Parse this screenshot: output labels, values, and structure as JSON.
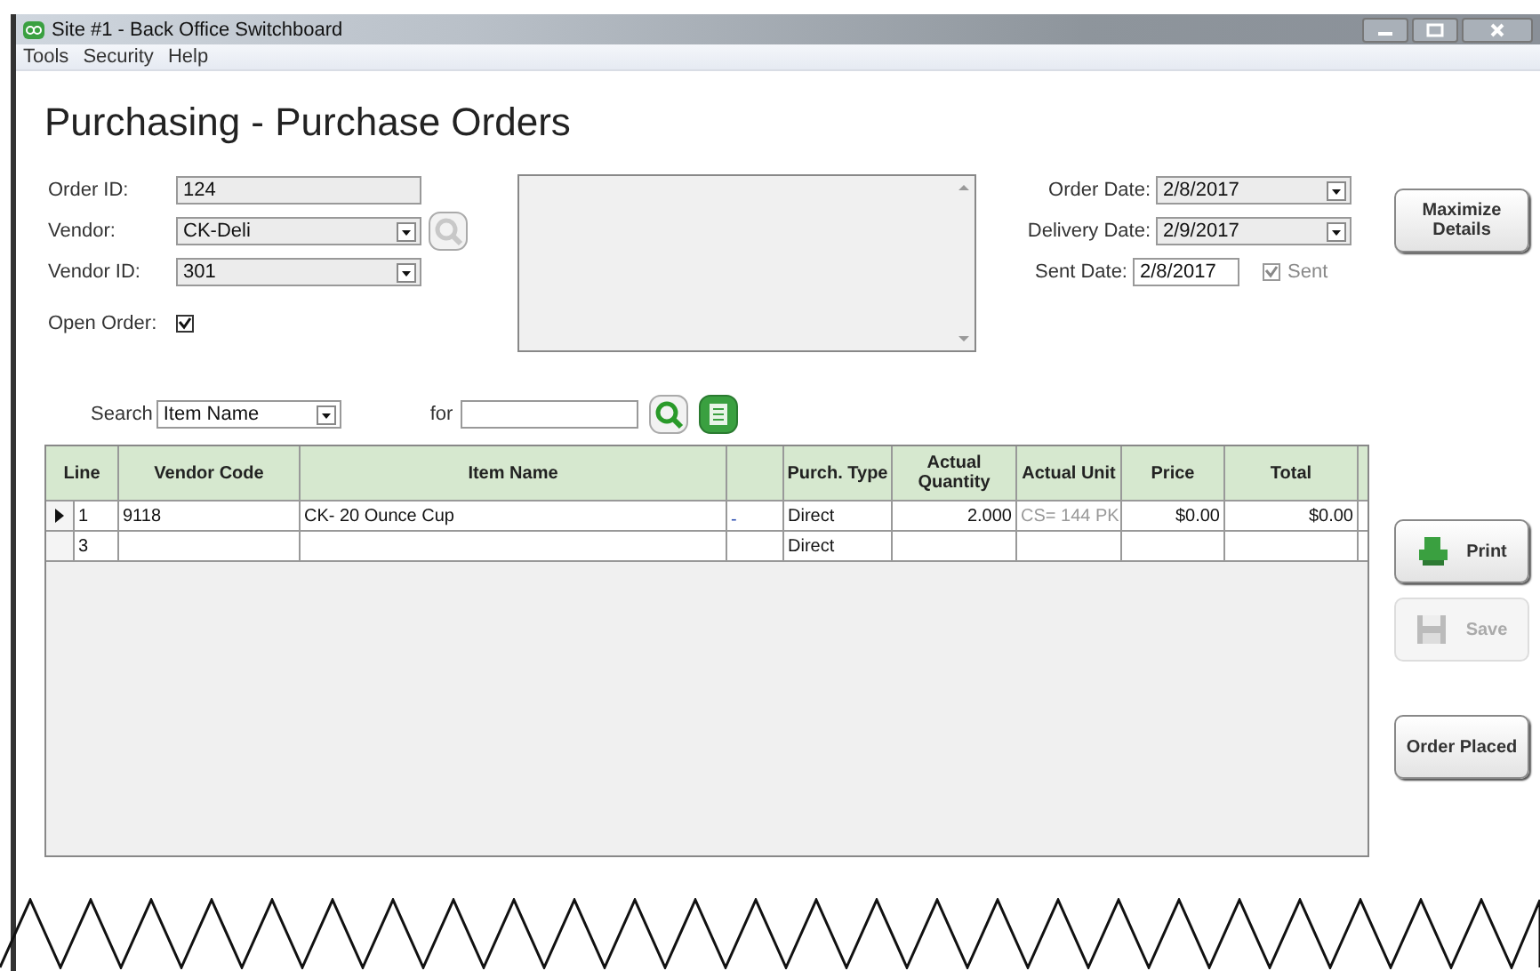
{
  "window": {
    "title": "Site #1 - Back Office Switchboard"
  },
  "menu": [
    "Tools",
    "Security",
    "Help"
  ],
  "page_title": "Purchasing - Purchase Orders",
  "fields": [
    {
      "label": "Order ID:",
      "value": "124",
      "kind": "text"
    },
    {
      "label": "Vendor:",
      "value": "CK-Deli",
      "kind": "combo-search"
    },
    {
      "label": "Vendor ID:",
      "value": "301",
      "kind": "combo"
    }
  ],
  "open_order": {
    "label": "Open Order:",
    "checked": true
  },
  "dates": [
    {
      "label": "Order Date:",
      "value": "2/8/2017",
      "kind": "combo"
    },
    {
      "label": "Delivery Date:",
      "value": "2/9/2017",
      "kind": "combo"
    },
    {
      "label": "Sent Date:",
      "value": "2/8/2017",
      "kind": "text"
    }
  ],
  "sent": {
    "label": "Sent",
    "checked": true,
    "disabled": true
  },
  "search": {
    "label": "Search",
    "value": "Item Name",
    "for_label": "for"
  },
  "table": {
    "columns": [
      "Line",
      "Vendor Code",
      "Item Name",
      "",
      "Purch. Type",
      "Actual Quantity",
      "Actual Unit",
      "Price",
      "Total"
    ],
    "rows": [
      {
        "selected": true,
        "cells": [
          "1",
          "9118",
          "CK- 20 Ounce Cup",
          "-",
          "Direct",
          "2.000",
          "CS= 144 PK",
          "$0.00",
          "$0.00"
        ]
      },
      {
        "selected": false,
        "cells": [
          "3",
          "",
          "",
          "",
          "Direct",
          "",
          "",
          "",
          ""
        ]
      }
    ]
  },
  "buttons": [
    {
      "label": "Maximize Details",
      "kind": "plain",
      "disabled": false
    },
    {
      "label": "Print",
      "kind": "print",
      "disabled": false
    },
    {
      "label": "Save",
      "kind": "save",
      "disabled": true
    },
    {
      "label": "Order Placed",
      "kind": "plain",
      "disabled": false
    }
  ]
}
